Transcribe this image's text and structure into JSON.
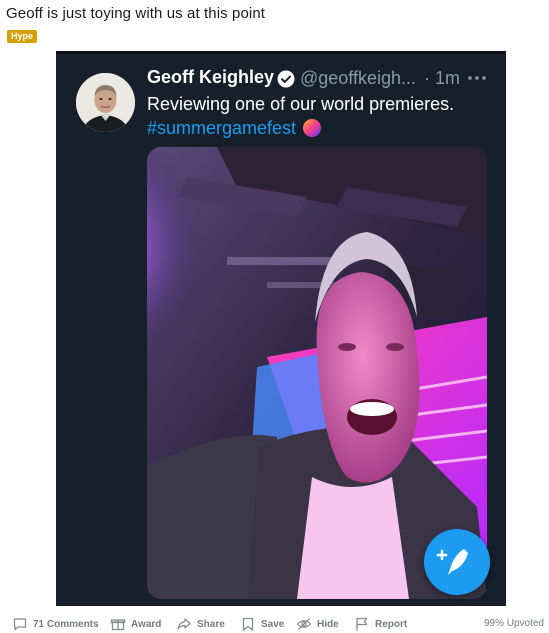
{
  "post": {
    "title": "Geoff is just toying with us at this point",
    "flair": "Hype"
  },
  "tweet": {
    "display_name": "Geoff Keighley",
    "handle": "@geoffkeigh...",
    "time": "· 1m",
    "text": "Reviewing one of our world premieres.",
    "hashtag": "#summergamefest",
    "accent_color": "#1d9bf0",
    "background_color": "#15202b"
  },
  "actions": {
    "comments_label": "71 Comments",
    "award_label": "Award",
    "share_label": "Share",
    "save_label": "Save",
    "hide_label": "Hide",
    "report_label": "Report",
    "upvoted_label": "99% Upvoted"
  },
  "icons": {
    "verified": "verified-badge-icon",
    "more": "more-dots-icon",
    "compose": "compose-feather-icon",
    "comment": "comment-icon",
    "award": "award-icon",
    "share": "share-arrow-icon",
    "save": "bookmark-icon",
    "hide": "eye-slash-icon",
    "report": "flag-icon"
  }
}
